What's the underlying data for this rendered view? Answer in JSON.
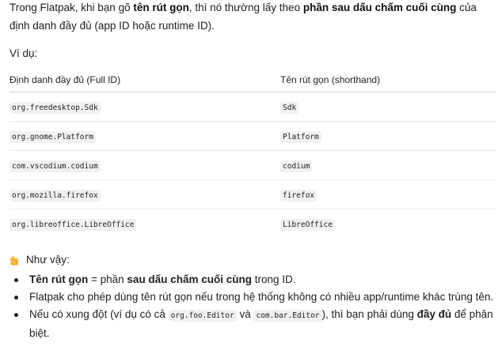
{
  "intro": {
    "t1": "Trong Flatpak, khi bạn gõ ",
    "b1": "tên rút gọn",
    "t2": ", thì nó thường lấy theo ",
    "b2": "phần sau dấu chấm cuối cùng",
    "t3": " của định danh đầy đủ (app ID hoặc runtime ID)."
  },
  "example_label": "Ví dụ:",
  "table": {
    "headers": [
      "Định danh đầy đủ (Full ID)",
      "Tên rút gọn (shorthand)"
    ],
    "rows": [
      [
        "org.freedesktop.Sdk",
        "Sdk"
      ],
      [
        "org.gnome.Platform",
        "Platform"
      ],
      [
        "com.vscodium.codium",
        "codium"
      ],
      [
        "org.mozilla.firefox",
        "firefox"
      ],
      [
        "org.libreoffice.LibreOffice",
        "LibreOffice"
      ]
    ]
  },
  "summary": {
    "icon": "pointing-hand-icon",
    "label": "Như vậy:"
  },
  "points": {
    "p1": {
      "b1": "Tên rút gọn",
      "t1": " = phần ",
      "b2": "sau dấu chấm cuối cùng",
      "t2": " trong ID."
    },
    "p2": {
      "t1": "Flatpak cho phép dùng tên rút gọn nếu trong hệ thống không có nhiều app/runtime khác trùng tên."
    },
    "p3": {
      "t1": "Nếu có xung đột (ví dụ có cả ",
      "c1": "org.foo.Editor",
      "t2": " và ",
      "c2": "com.bar.Editor",
      "t3": "), thì bạn phải dùng ",
      "b1": "đầy đủ",
      "t4": " để phân biệt."
    }
  },
  "colors": {
    "text": "#1f1f1f",
    "code_bg": "#f1f1f1",
    "hand": "#f4b63f"
  }
}
